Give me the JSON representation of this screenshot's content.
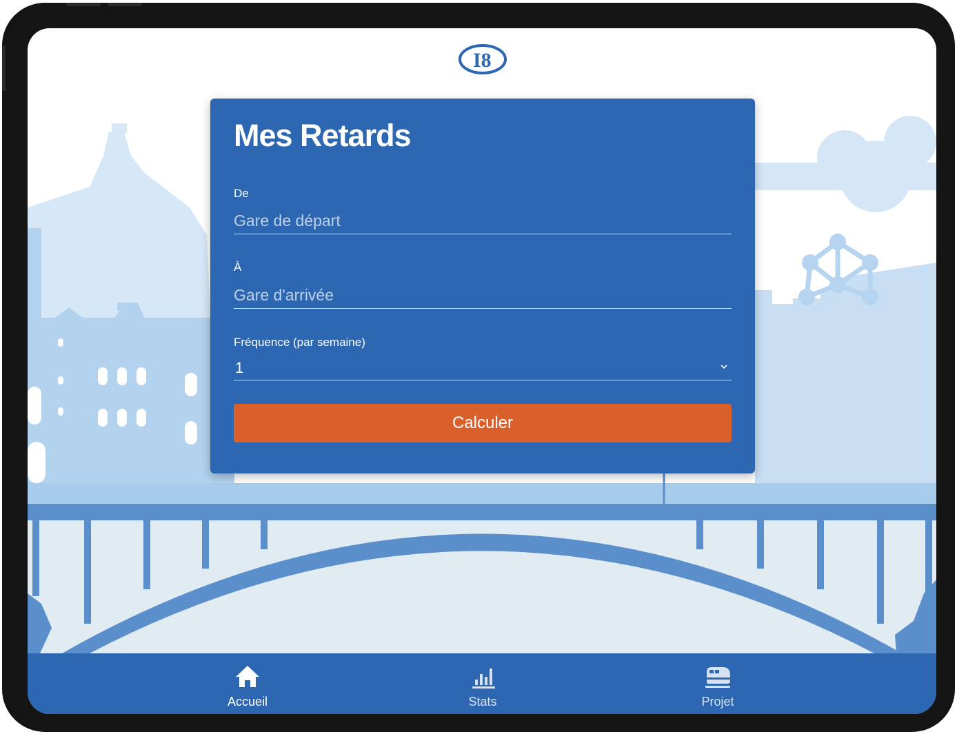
{
  "app": {
    "logo_icon": "l8-logo-icon",
    "brand_color": "#2d67b1",
    "accent_color": "#d9602b"
  },
  "form": {
    "title": "Mes Retards",
    "from_label": "De",
    "from_placeholder": "Gare de départ",
    "to_label": "À",
    "to_placeholder": "Gare d'arrivée",
    "frequency_label": "Fréquence (par semaine)",
    "frequency_value": "1",
    "submit_label": "Calculer"
  },
  "tabbar": {
    "active": "Accueil",
    "items": [
      {
        "label": "Accueil",
        "icon": "home-icon"
      },
      {
        "label": "Stats",
        "icon": "bar-chart-icon"
      },
      {
        "label": "Projet",
        "icon": "train-icon"
      }
    ]
  }
}
